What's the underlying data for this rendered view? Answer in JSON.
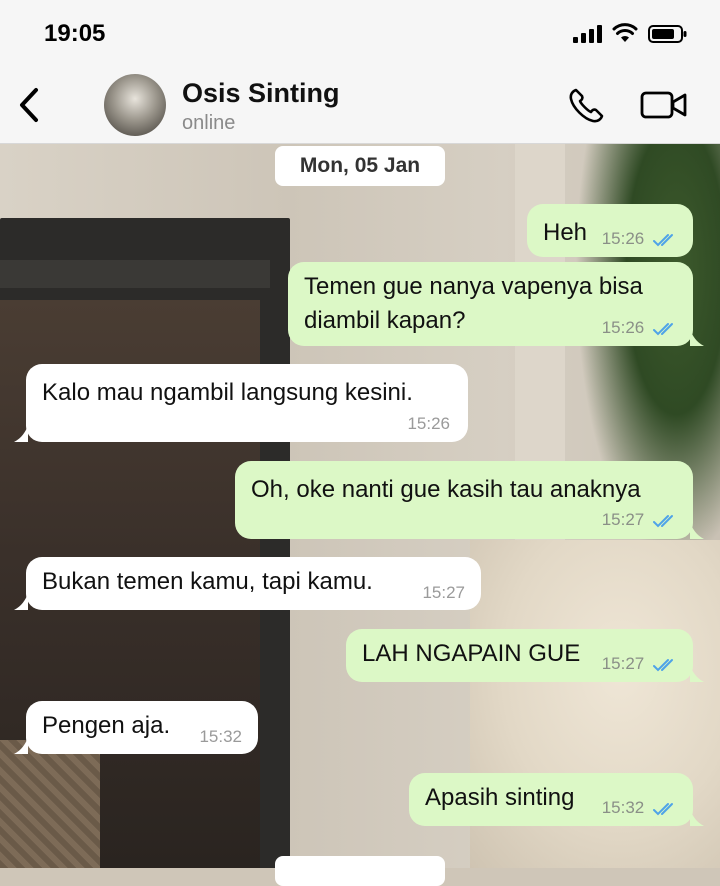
{
  "status_bar": {
    "time": "19:05"
  },
  "header": {
    "contact_name": "Osis Sinting",
    "contact_status": "online"
  },
  "date_separator": "Mon, 05 Jan",
  "messages": [
    {
      "direction": "out",
      "text": "Heh",
      "time": "15:26",
      "read": true
    },
    {
      "direction": "out",
      "text_lines": [
        "Temen gue nanya vapenya bisa",
        "diambil kapan?"
      ],
      "time": "15:26",
      "read": true
    },
    {
      "direction": "in",
      "text": "Kalo mau ngambil langsung kesini.",
      "time": "15:26"
    },
    {
      "direction": "out",
      "text": "Oh, oke nanti gue kasih tau anaknya",
      "time": "15:27",
      "read": true
    },
    {
      "direction": "in",
      "text": "Bukan temen kamu, tapi kamu.",
      "time": "15:27"
    },
    {
      "direction": "out",
      "text": "LAH NGAPAIN GUE",
      "time": "15:27",
      "read": true
    },
    {
      "direction": "in",
      "text": "Pengen aja.",
      "time": "15:32"
    },
    {
      "direction": "out",
      "text": "Apasih sinting",
      "time": "15:32",
      "read": true
    }
  ],
  "colors": {
    "outgoing_bubble": "#dcf8c6",
    "incoming_bubble": "#ffffff",
    "read_ticks": "#4fa3e8"
  }
}
